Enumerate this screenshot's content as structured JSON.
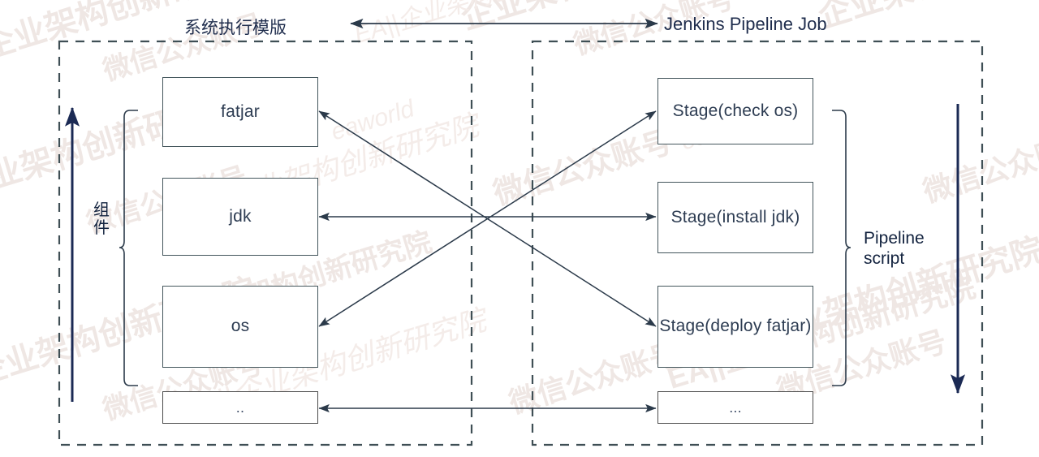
{
  "diagram": {
    "title_left": "系统执行模版",
    "title_right": "Jenkins Pipeline Job",
    "left_group_label": "组\n件",
    "right_group_label": "Pipeline\nscript",
    "colors": {
      "box_border": "#44565c",
      "box_fill": "#ffffff",
      "arrow": "#2b3a4a",
      "accent_arrow": "#1b2a54",
      "dashed_border": "#3f4f55",
      "text": "#1f2d4d",
      "watermark": "#efe7e4"
    },
    "left_panel": {
      "name": "系统执行模版",
      "nodes": [
        {
          "id": "fatjar",
          "label": "fatjar"
        },
        {
          "id": "jdk",
          "label": "jdk"
        },
        {
          "id": "os",
          "label": "os"
        },
        {
          "id": "more",
          "label": ".."
        }
      ]
    },
    "right_panel": {
      "name": "Jenkins Pipeline Job",
      "nodes": [
        {
          "id": "stage-check-os",
          "label": "Stage(check os)"
        },
        {
          "id": "stage-install-jdk",
          "label": "Stage(install jdk)"
        },
        {
          "id": "stage-deploy-fatjar",
          "label": "Stage(deploy fatjar)"
        },
        {
          "id": "stage-more",
          "label": "..."
        }
      ]
    },
    "connections": [
      {
        "from": "title_left",
        "to": "title_right",
        "style": "double-arrow"
      },
      {
        "from": "os",
        "to": "stage-check-os",
        "style": "double-arrow"
      },
      {
        "from": "jdk",
        "to": "stage-install-jdk",
        "style": "double-arrow"
      },
      {
        "from": "fatjar",
        "to": "stage-deploy-fatjar",
        "style": "double-arrow"
      },
      {
        "from": "more",
        "to": "stage-more",
        "style": "double-arrow"
      }
    ],
    "watermarks": {
      "cn_a": "企业架构创新研究院",
      "cn_b": "微信公众账号",
      "en_a": "eaworld",
      "en_b": "EA||企业架构创新研究院"
    }
  }
}
